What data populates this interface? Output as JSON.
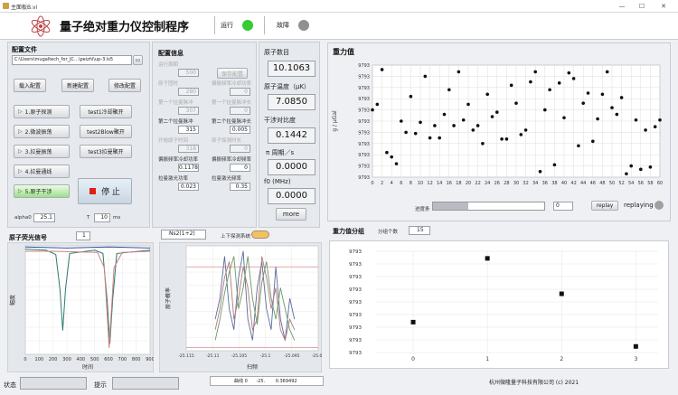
{
  "window": {
    "title": "主面板B.vi",
    "minimize": "—",
    "maximize": "☐",
    "close": "✕"
  },
  "header": {
    "title": "量子绝对重力仪控制程序",
    "run_label": "运行",
    "fault_label": "故障",
    "run_color": "#33cc33",
    "fault_color": "#909090"
  },
  "config_file": {
    "label": "配置文件",
    "path": "C:\\Users\\mugaltech_for_JC...\\peizhi\\up-3.ls5",
    "load_btn": "载入配置",
    "new_btn": "新建配置",
    "edit_btn": "修改配置"
  },
  "sequence": {
    "buttons": [
      "1.原子探测",
      "2.微波振荡",
      "3.拉曼振荡",
      "4.拉曼通线",
      "5.原子干涉"
    ],
    "test_buttons": [
      "test1冷却聚开",
      "test2Blow聚开",
      "test3拉曼聚开"
    ],
    "stop_label": "停 止",
    "alpha_label": "alpha0",
    "alpha_value": "25.1",
    "t_label": "T",
    "t_value": "10",
    "t_unit": "ms"
  },
  "config_info": {
    "title": "配置信息",
    "fields": [
      {
        "label": "运行周期",
        "value": "500",
        "disabled": true
      },
      {
        "label": "原子团时",
        "value": "280",
        "disabled": true
      },
      {
        "label": "第一个拉曼脉冲",
        "value": "307",
        "disabled": true
      },
      {
        "label": "第二个拉曼脉冲",
        "value": "315",
        "disabled": false
      },
      {
        "label": "开始原子时间",
        "value": "318",
        "disabled": true
      },
      {
        "label": "偏振频率冷却功率",
        "value": "0.1178",
        "disabled": false
      },
      {
        "label": "拉曼激光功率",
        "value": "0.023",
        "disabled": false
      }
    ],
    "fields_right": [
      {
        "label": "保存配置",
        "value": "",
        "disabled": true
      },
      {
        "label": "偏振频率冷却功率",
        "value": "0",
        "disabled": true
      },
      {
        "label": "第一个拉曼脉冲长",
        "value": "0",
        "disabled": true
      },
      {
        "label": "第二个拉曼脉冲长",
        "value": "0.005",
        "disabled": false
      },
      {
        "label": "原子探测时长",
        "value": "0",
        "disabled": true
      },
      {
        "label": "偏振频率冷却频率",
        "value": "0",
        "disabled": false
      },
      {
        "label": "拉曼激光频率",
        "value": "0.35",
        "disabled": false
      }
    ]
  },
  "stats": {
    "atom_count_label": "原子数目",
    "atom_count": "10.1063",
    "atom_temp_label": "原子温度（μK）",
    "atom_temp": "7.0850",
    "contrast_label": "干涉对比度",
    "contrast": "0.1442",
    "period_label": "π 周期／s",
    "period": "0.0000",
    "f0_label": "f0 (MHz)",
    "f0": "0.0000",
    "more_btn": "more"
  },
  "gravity": {
    "title": "重力值",
    "ylabel": "g / μGal",
    "progress_label": "进度条",
    "progress_value": "0",
    "progress_fraction": 0.32,
    "replay_btn": "replay",
    "replaying_label": "replaying"
  },
  "distribution": {
    "title": "重力值分组",
    "groups_label": "分组个数",
    "groups_value": "15"
  },
  "fluorescence": {
    "title": "原子荧光信号",
    "index": "1",
    "xlabel": "时间",
    "ylabel": "幅度"
  },
  "fringe": {
    "select": "Ns2(1+2)",
    "toggle_label": "上下探测系统",
    "xlabel": "扫频",
    "ylabel": "原子概率",
    "legend_name": "曲线 0",
    "legend_val1": "-25.",
    "legend_val2": "0.369492"
  },
  "footer": {
    "status_label": "状态",
    "hint_label": "提示",
    "company": "杭州微隆量子科技有限公司 (c) 2021"
  },
  "chart_data": [
    {
      "type": "scatter",
      "title": "重力值",
      "ylabel": "g / μGal",
      "xlim": [
        0,
        60
      ],
      "x_ticks": [
        0,
        2,
        4,
        6,
        8,
        10,
        12,
        14,
        16,
        18,
        20,
        22,
        24,
        26,
        28,
        30,
        32,
        34,
        36,
        38,
        40,
        42,
        44,
        46,
        48,
        50,
        52,
        54,
        56,
        58,
        60
      ],
      "y_ticks": [
        "9793",
        "9793",
        "9793",
        "9793",
        "9793",
        "9793",
        "9793",
        "9793",
        "9793",
        "9793",
        "9793"
      ],
      "y_norm": [
        0,
        1
      ],
      "points": [
        [
          0,
          0.6
        ],
        [
          1,
          0.65
        ],
        [
          2,
          0.96
        ],
        [
          3,
          0.22
        ],
        [
          4,
          0.18
        ],
        [
          5,
          0.12
        ],
        [
          6,
          0.5
        ],
        [
          7,
          0.4
        ],
        [
          8,
          0.72
        ],
        [
          9,
          0.39
        ],
        [
          10,
          0.49
        ],
        [
          11,
          0.9
        ],
        [
          12,
          0.35
        ],
        [
          13,
          0.46
        ],
        [
          14,
          0.35
        ],
        [
          15,
          0.56
        ],
        [
          16,
          0.78
        ],
        [
          17,
          0.46
        ],
        [
          18,
          0.94
        ],
        [
          19,
          0.51
        ],
        [
          20,
          0.65
        ],
        [
          21,
          0.42
        ],
        [
          22,
          0.46
        ],
        [
          23,
          0.3
        ],
        [
          24,
          0.74
        ],
        [
          25,
          0.54
        ],
        [
          26,
          0.58
        ],
        [
          27,
          0.34
        ],
        [
          28,
          0.34
        ],
        [
          29,
          0.82
        ],
        [
          30,
          0.66
        ],
        [
          31,
          0.38
        ],
        [
          32,
          0.42
        ],
        [
          33,
          0.85
        ],
        [
          34,
          0.94
        ],
        [
          35,
          0.05
        ],
        [
          36,
          0.6
        ],
        [
          37,
          0.78
        ],
        [
          38,
          0.11
        ],
        [
          39,
          0.84
        ],
        [
          40,
          0.53
        ],
        [
          41,
          0.93
        ],
        [
          42,
          0.88
        ],
        [
          43,
          0.28
        ],
        [
          44,
          0.66
        ],
        [
          45,
          0.75
        ],
        [
          46,
          0.32
        ],
        [
          47,
          0.52
        ],
        [
          48,
          0.74
        ],
        [
          49,
          0.94
        ],
        [
          50,
          0.62
        ],
        [
          51,
          0.56
        ],
        [
          52,
          0.71
        ],
        [
          53,
          0.03
        ],
        [
          54,
          0.1
        ],
        [
          55,
          0.51
        ],
        [
          56,
          0.07
        ],
        [
          57,
          0.42
        ],
        [
          58,
          0.09
        ],
        [
          59,
          0.45
        ],
        [
          60,
          0.51
        ]
      ]
    },
    {
      "type": "scatter",
      "title": "重力值分组",
      "xlim": [
        -0.5,
        3.3
      ],
      "x_ticks": [
        0,
        1,
        2,
        3
      ],
      "y_ticks": [
        "9793",
        "9793",
        "9793",
        "9793",
        "9793",
        "9793",
        "9793",
        "9793",
        "9793"
      ],
      "points": [
        [
          0,
          0.3
        ],
        [
          1,
          0.93
        ],
        [
          2,
          0.58
        ],
        [
          3,
          0.06
        ]
      ]
    },
    {
      "type": "line",
      "title": "原子荧光信号",
      "xlabel": "时间",
      "ylabel": "幅度",
      "xlim": [
        0,
        900
      ],
      "x_ticks": [
        0,
        100,
        200,
        300,
        400,
        500,
        600,
        700,
        800,
        900
      ],
      "series": [
        {
          "color": "#2a7a6e",
          "points": [
            [
              0,
              0.97
            ],
            [
              150,
              0.96
            ],
            [
              220,
              0.92
            ],
            [
              250,
              0.6
            ],
            [
              270,
              0.22
            ],
            [
              290,
              0.6
            ],
            [
              320,
              0.93
            ],
            [
              500,
              0.96
            ],
            [
              560,
              0.93
            ],
            [
              590,
              0.5
            ],
            [
              610,
              0.1
            ],
            [
              630,
              0.5
            ],
            [
              660,
              0.93
            ],
            [
              900,
              0.96
            ]
          ]
        },
        {
          "color": "#d08080",
          "points": [
            [
              0,
              0.95
            ],
            [
              200,
              0.95
            ],
            [
              520,
              0.94
            ],
            [
              570,
              0.8
            ],
            [
              605,
              0.06
            ],
            [
              640,
              0.8
            ],
            [
              700,
              0.94
            ],
            [
              900,
              0.95
            ]
          ]
        },
        {
          "color": "#3050a0",
          "points": [
            [
              0,
              0.99
            ],
            [
              300,
              0.98
            ],
            [
              600,
              0.99
            ],
            [
              900,
              0.98
            ]
          ]
        }
      ]
    },
    {
      "type": "line",
      "title": "扫频",
      "xlabel": "扫频",
      "ylabel": "原子概率",
      "x_ticks": [
        "-25.115",
        "-25.11",
        "-25.105",
        "-25.1",
        "-25.095",
        "-25.09"
      ],
      "series": [
        {
          "color": "#5c6a9a",
          "values": [
            0.3,
            0.5,
            0.9,
            0.4,
            0.2,
            0.7,
            0.95,
            0.3,
            0.1,
            0.6,
            0.85,
            0.4,
            0.2,
            0.8,
            0.3,
            0.1,
            0.5,
            0.3
          ]
        },
        {
          "color": "#b07a7a",
          "values": [
            0.2,
            0.4,
            0.7,
            0.85,
            0.3,
            0.5,
            0.8,
            0.6,
            0.2,
            0.3,
            0.9,
            0.7,
            0.4,
            0.6,
            0.2,
            0.1,
            0.3,
            0.2
          ]
        },
        {
          "color": "#6a9a6a",
          "values": [
            0.1,
            0.3,
            0.55,
            0.75,
            0.9,
            0.4,
            0.6,
            0.9,
            0.5,
            0.25,
            0.65,
            0.85,
            0.5,
            0.3,
            0.6,
            0.4,
            0.2,
            0.1
          ]
        }
      ]
    }
  ]
}
